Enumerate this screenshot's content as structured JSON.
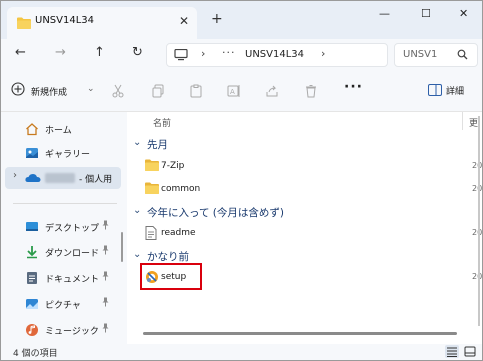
{
  "window": {
    "tab_title": "UNSV14L34",
    "new_tab": "+",
    "minimize": "—",
    "maximize": "☐",
    "close": "✕",
    "tab_close": "✕"
  },
  "nav": {
    "back": "←",
    "forward": "→",
    "up": "↑",
    "refresh": "↻",
    "address_sep": "›",
    "address_more": "···",
    "address_path": "UNSV14L34",
    "search_placeholder": "UNSV1"
  },
  "toolbar": {
    "new_label": "新規作成",
    "new_chevron": "⌄",
    "more": "···",
    "details_label": "詳細",
    "icons": [
      "cut-icon",
      "copy-icon",
      "paste-icon",
      "rename-icon",
      "share-icon",
      "delete-icon"
    ]
  },
  "sidebar": {
    "items": [
      {
        "label": "ホーム",
        "icon": "home-icon"
      },
      {
        "label": "ギャラリー",
        "icon": "gallery-icon"
      },
      {
        "label": "- 個人用",
        "icon": "onedrive-icon"
      },
      {
        "label": "デスクトップ",
        "icon": "desktop-icon"
      },
      {
        "label": "ダウンロード",
        "icon": "download-icon"
      },
      {
        "label": "ドキュメント",
        "icon": "document-icon"
      },
      {
        "label": "ピクチャ",
        "icon": "pictures-icon"
      },
      {
        "label": "ミュージック",
        "icon": "music-icon"
      }
    ],
    "pin": "📌",
    "expand_chevron": "›"
  },
  "content": {
    "col_name": "名前",
    "col_date": "更",
    "group_chevron": "⌄",
    "groups": [
      {
        "label": "先月",
        "items": [
          {
            "name": "7-Zip",
            "date": "20"
          },
          {
            "name": "common",
            "date": "20"
          }
        ]
      },
      {
        "label": "今年に入って (今月は含めず)",
        "items": [
          {
            "name": "readme",
            "date": "20"
          }
        ]
      },
      {
        "label": "かなり前",
        "items": [
          {
            "name": "setup",
            "date": "20"
          }
        ]
      }
    ]
  },
  "status": {
    "item_count": "4 個の項目"
  },
  "colors": {
    "accent": "#1a3a6e",
    "highlight_border": "#d9000d",
    "folder": "#f4c542",
    "chrome": "#e8eef6"
  }
}
